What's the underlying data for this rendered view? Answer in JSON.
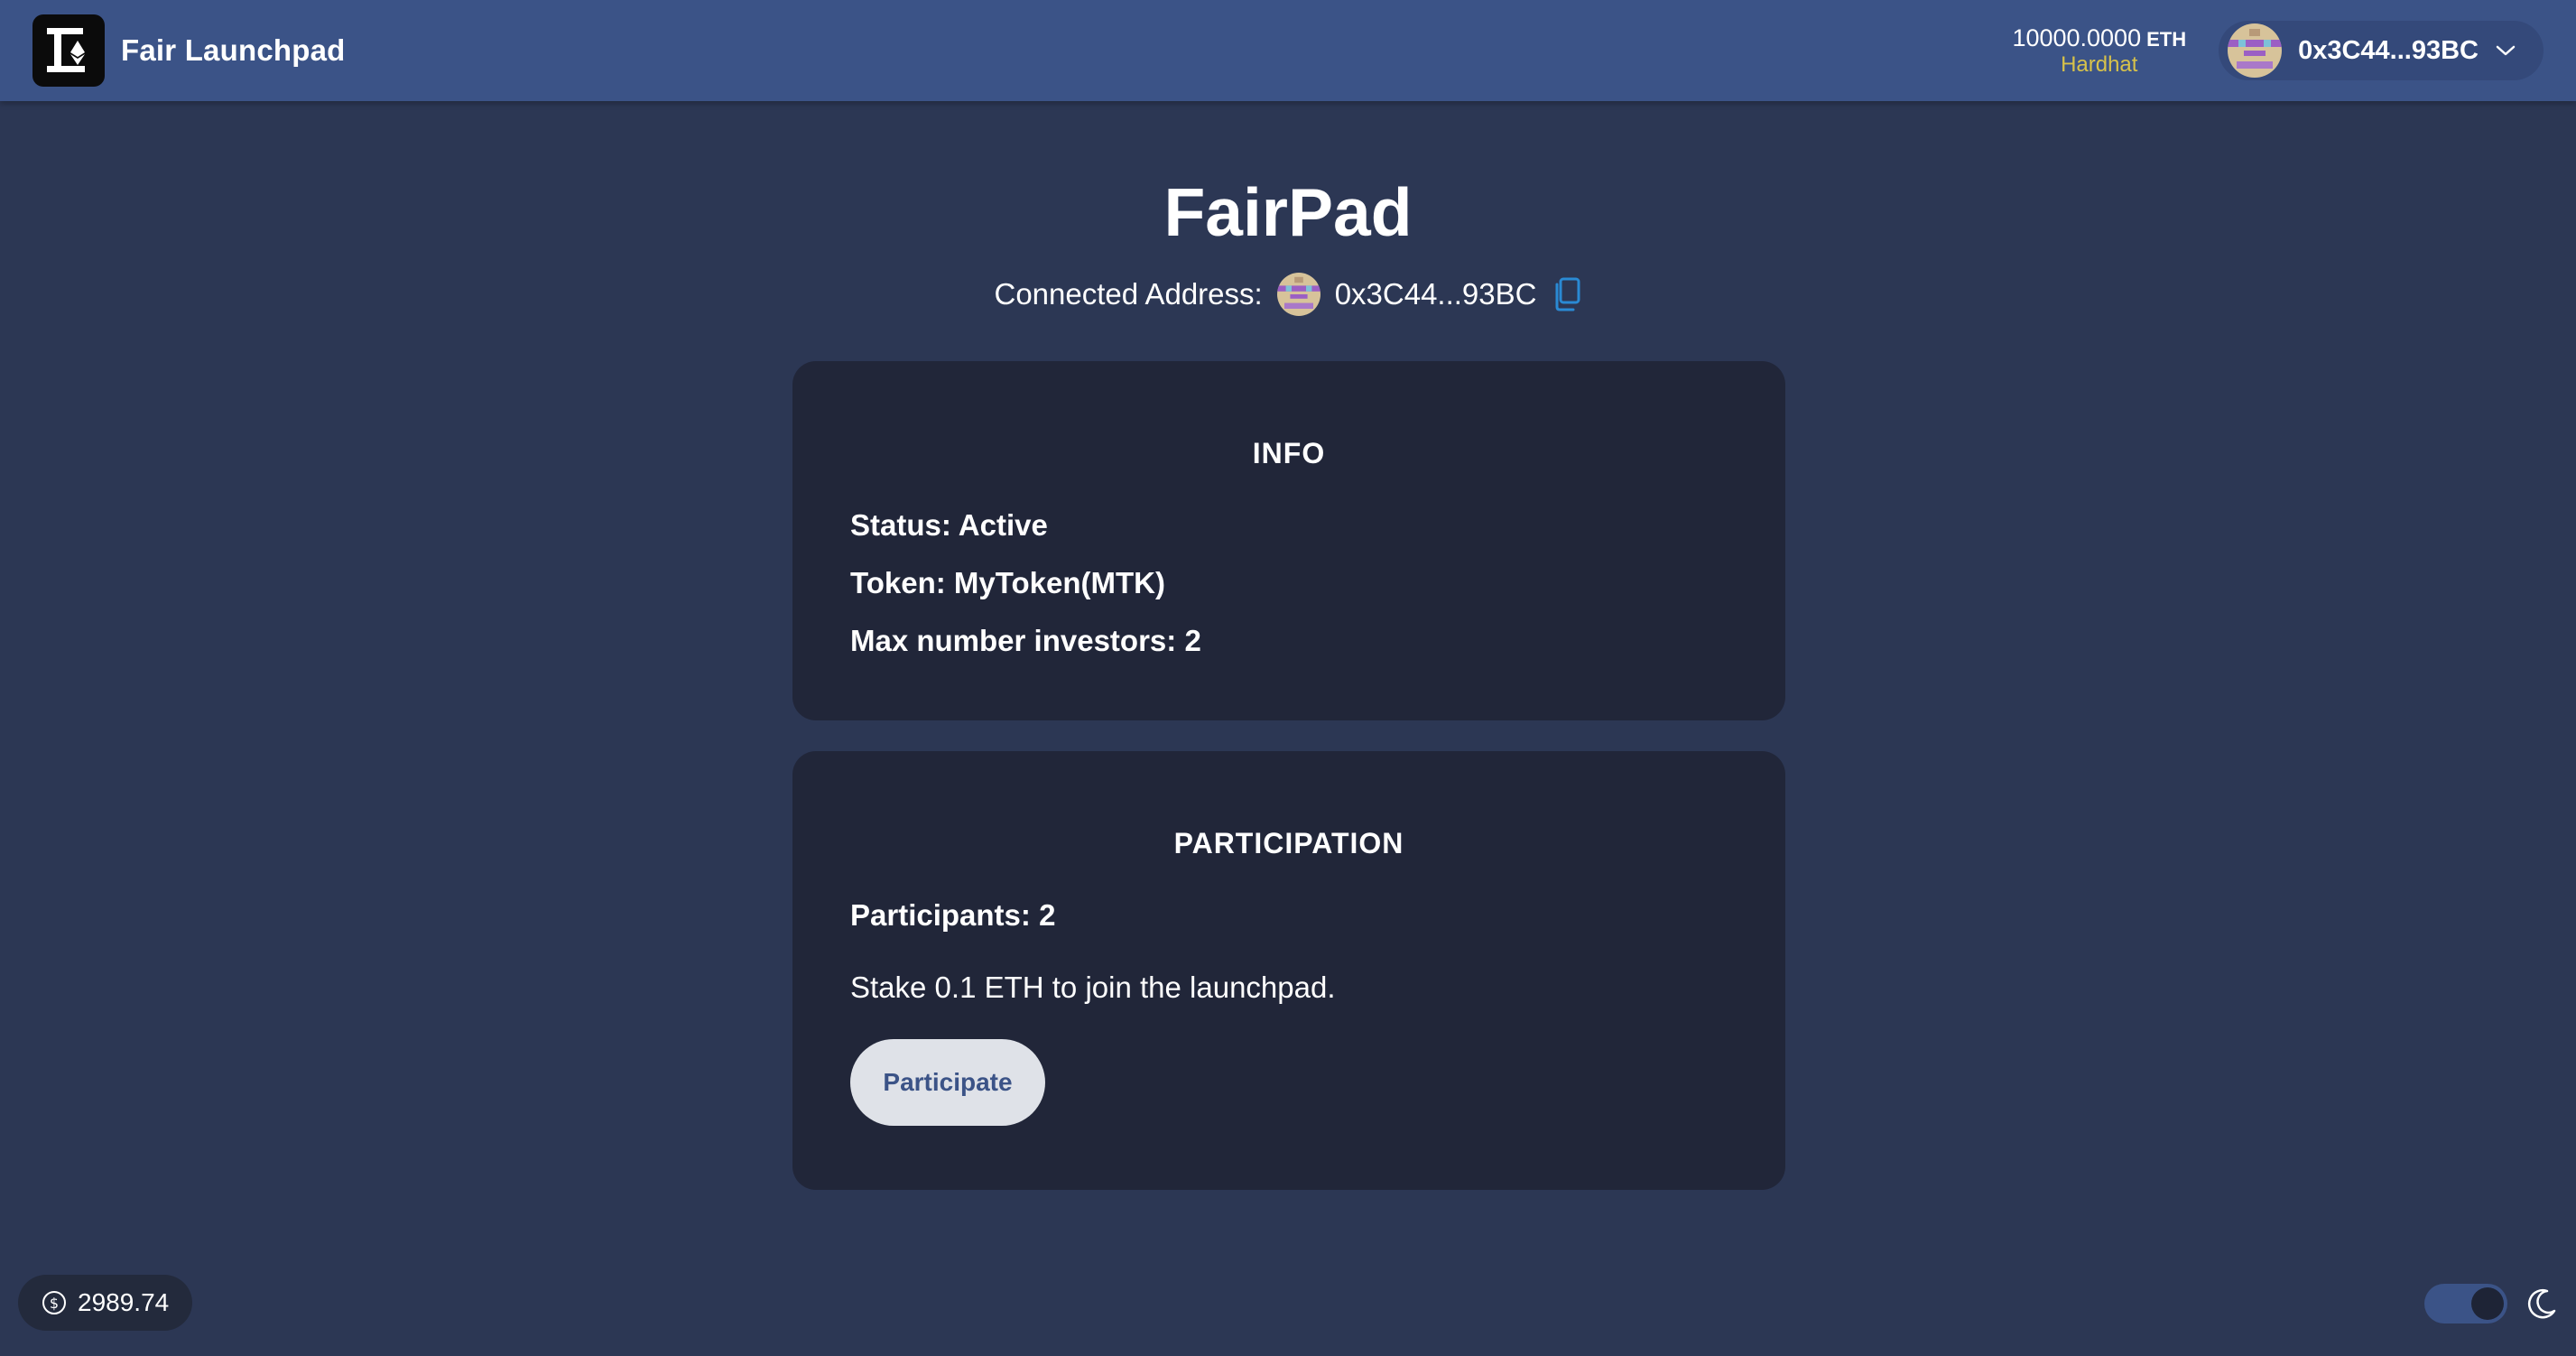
{
  "navbar": {
    "brand_name": "Fair Launchpad",
    "balance_amount": "10000.0000",
    "balance_unit": "ETH",
    "network": "Hardhat",
    "account_address": "0x3C44...93BC",
    "icons": {
      "logo": "launchpad-logo-icon",
      "avatar": "blockie-avatar-icon",
      "dropdown": "chevron-down-icon"
    }
  },
  "header": {
    "title": "FairPad",
    "connected_label": "Connected Address:",
    "connected_address": "0x3C44...93BC"
  },
  "info_card": {
    "heading": "INFO",
    "status_label": "Status:",
    "status_value": "Active",
    "token_label": "Token:",
    "token_value": "MyToken(MTK)",
    "max_investors_label": "Max number investors:",
    "max_investors_value": "2"
  },
  "participation_card": {
    "heading": "PARTICIPATION",
    "participants_label": "Participants:",
    "participants_value": "2",
    "stake_text": "Stake 0.1 ETH to join the launchpad.",
    "button_label": "Participate"
  },
  "footer": {
    "eth_price": "2989.74",
    "theme": "dark"
  },
  "colors": {
    "navbar": "#3b5387",
    "background": "#2c3754",
    "card": "#212639",
    "network": "#d7c24a",
    "copy_icon": "#2a8ad4",
    "button_text": "#3b5387"
  }
}
